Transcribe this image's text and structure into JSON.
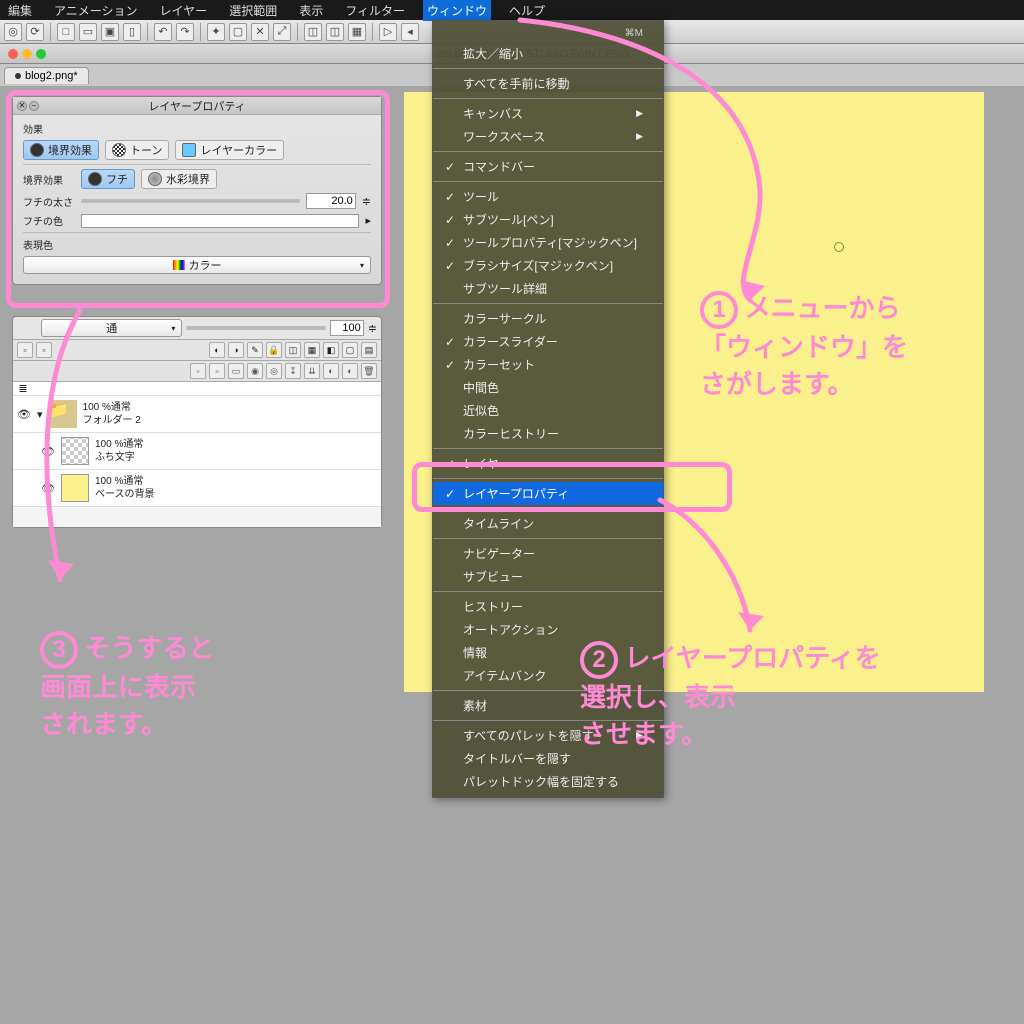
{
  "menubar": [
    "編集",
    "アニメーション",
    "レイヤー",
    "選択範囲",
    "表示",
    "フィルター",
    "ウィンドウ",
    "ヘルプ"
  ],
  "menubar_active_index": 6,
  "titlebar_suffix": "dpi 50.0%)  -  CLIP STUDIO PAINT PRO",
  "tab": "blog2.png*",
  "prop": {
    "title": "レイヤープロパティ",
    "effect_label": "効果",
    "opts": [
      "境界効果",
      "トーン",
      "レイヤーカラー"
    ],
    "border_effect_label": "境界効果",
    "border_opts": [
      "フチ",
      "水彩境界"
    ],
    "thickness_label": "フチの太さ",
    "thickness_value": "20.0",
    "edge_color_label": "フチの色",
    "expr_label": "表現色",
    "expr_value": "カラー"
  },
  "layers": {
    "mode": "通",
    "opacity": "100",
    "rows": [
      {
        "label1": "100 %通常",
        "label2": "フォルダー 2",
        "type": "folder"
      },
      {
        "label1": "100 %通常",
        "label2": "ふち文字",
        "type": "checker"
      },
      {
        "label1": "100 %通常",
        "label2": "ベースの背景",
        "type": "yellow"
      }
    ]
  },
  "menu": {
    "shortcut": "⌘M",
    "items": [
      {
        "t": "拡大／縮小"
      },
      {
        "sep": true
      },
      {
        "t": "すべてを手前に移動"
      },
      {
        "sep": true
      },
      {
        "t": "キャンバス",
        "sub": true
      },
      {
        "t": "ワークスペース",
        "sub": true
      },
      {
        "sep": true
      },
      {
        "t": "コマンドバー",
        "c": true
      },
      {
        "sep": true
      },
      {
        "t": "ツール",
        "c": true
      },
      {
        "t": "サブツール[ペン]",
        "c": true
      },
      {
        "t": "ツールプロパティ[マジックペン]",
        "c": true
      },
      {
        "t": "ブラシサイズ[マジックペン]",
        "c": true
      },
      {
        "t": "サブツール詳細"
      },
      {
        "sep": true
      },
      {
        "t": "カラーサークル"
      },
      {
        "t": "カラースライダー",
        "c": true
      },
      {
        "t": "カラーセット",
        "c": true
      },
      {
        "t": "中間色"
      },
      {
        "t": "近似色"
      },
      {
        "t": "カラーヒストリー"
      },
      {
        "sep": true
      },
      {
        "t": "レイヤー",
        "c": true
      },
      {
        "sep": true
      },
      {
        "t": "レイヤープロパティ",
        "c": true,
        "sel": true
      },
      {
        "sep": true
      },
      {
        "t": "タイムライン"
      },
      {
        "sep": true
      },
      {
        "t": "ナビゲーター"
      },
      {
        "t": "サブビュー"
      },
      {
        "sep": true
      },
      {
        "t": "ヒストリー"
      },
      {
        "t": "オートアクション"
      },
      {
        "t": "情報"
      },
      {
        "t": "アイテムバンク"
      },
      {
        "sep": true
      },
      {
        "t": "素材"
      },
      {
        "sep": true
      },
      {
        "t": "すべてのパレットを隠す",
        "sub": true
      },
      {
        "t": "タイトルバーを隠す"
      },
      {
        "t": "パレットドック幅を固定する"
      }
    ]
  },
  "annotations": {
    "n1": "メニューから\n「ウィンドウ」を\nさがします。",
    "n2": "レイヤープロパティを\n選択し、表示\nさせます。",
    "n3": "そうすると\n画面上に表示\nされます。"
  }
}
